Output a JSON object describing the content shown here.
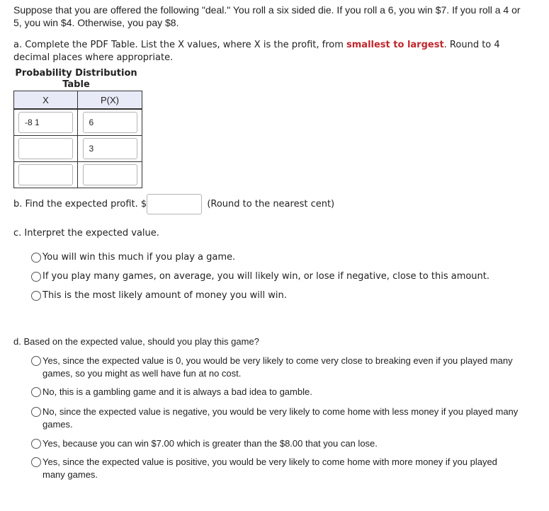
{
  "intro": {
    "text": "Suppose that you are offered the following \"deal.\" You roll a six sided die. If you roll a 6, you win $7. If you roll a 4 or 5, you win $4. Otherwise, you pay $8."
  },
  "part_a": {
    "prefix": "a. Complete the PDF Table. List the X values, where X is the profit, from ",
    "emphasis": "smallest to largest",
    "suffix": ". Round to 4 decimal places where appropriate.",
    "table_title_line1": "Probability Distribution",
    "table_title_line2": "Table",
    "headers": [
      "X",
      "P(X)"
    ],
    "rows": [
      {
        "x": "-8 1",
        "p": "6"
      },
      {
        "x": "",
        "p": "3"
      },
      {
        "x": "",
        "p": ""
      }
    ]
  },
  "part_b": {
    "label": "b. Find the expected profit. $",
    "value": "",
    "hint": "(Round to the nearest cent)"
  },
  "part_c": {
    "label": "c. Interpret the expected value.",
    "options": [
      "You will win this much if you play a game.",
      "If you play many games, on average, you will likely win, or lose if negative, close to this amount.",
      "This is the most likely amount of money you will win."
    ]
  },
  "part_d": {
    "label": "d. Based on the expected value, should you play this game?",
    "options": [
      "Yes, since the expected value is 0, you would be very likely to come very close to breaking even if you played many games, so you might as well have fun at no cost.",
      "No, this is a gambling game and it is always a bad idea to gamble.",
      "No, since the expected value is negative, you would be very likely to come home with less money if you played many games.",
      "Yes, because you can win $7.00 which is greater than the $8.00 that you can lose.",
      "Yes, since the expected value is positive, you would be very likely to come home with more money if you played many games."
    ]
  }
}
